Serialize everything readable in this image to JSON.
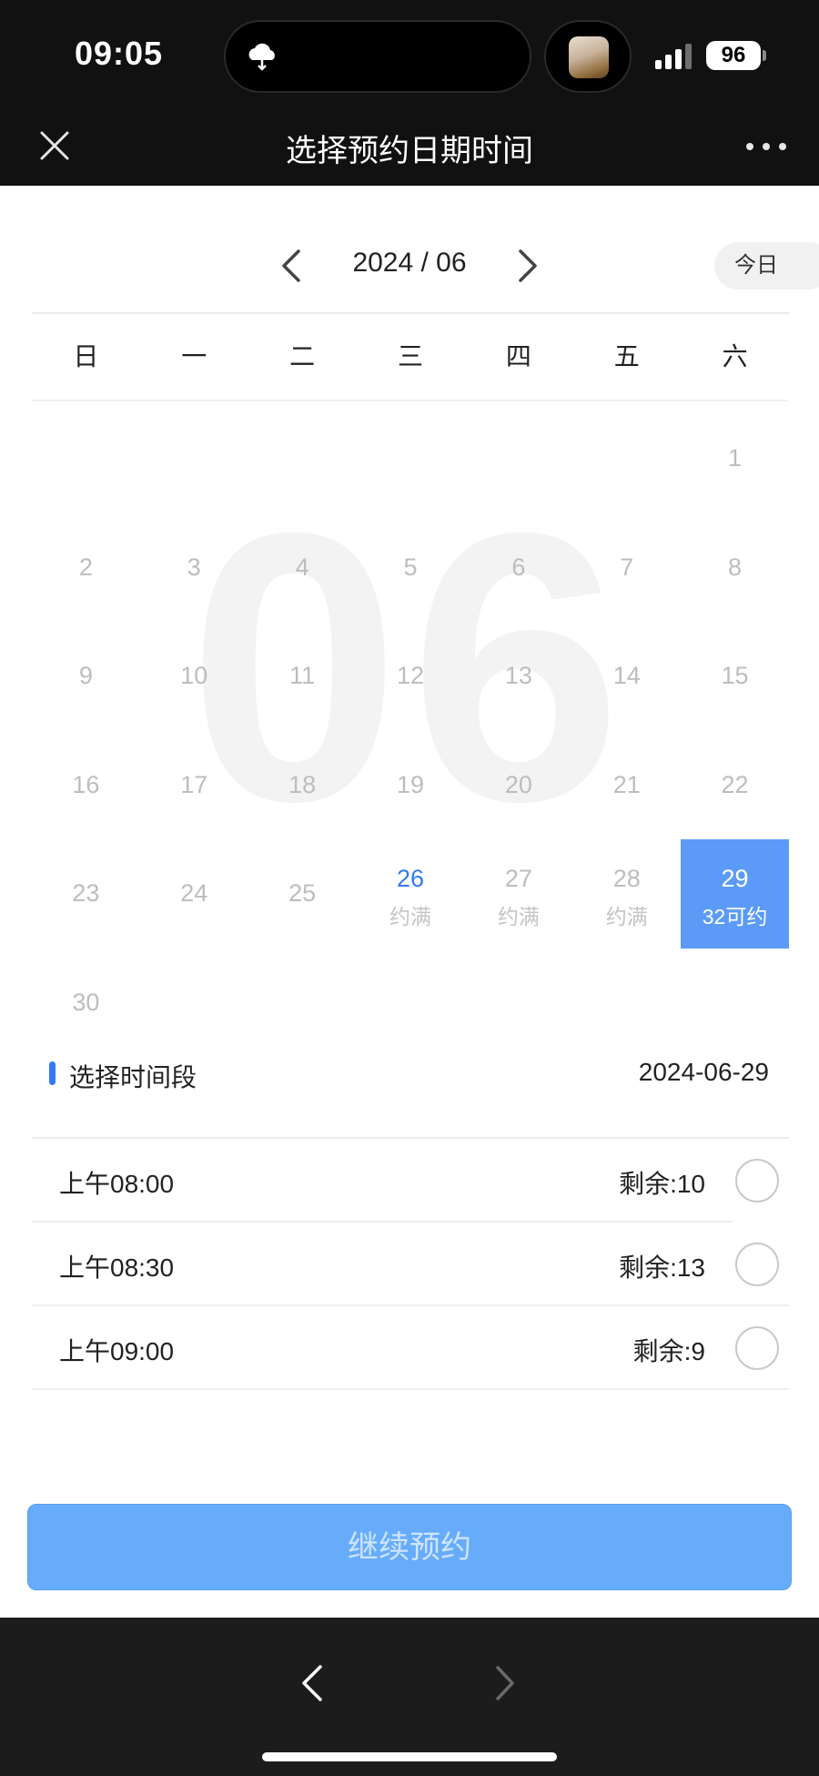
{
  "status_bar": {
    "time": "09:05",
    "battery": "96"
  },
  "header": {
    "title": "选择预约日期时间",
    "close_icon": "close-icon",
    "more_icon": "more-icon"
  },
  "calendar": {
    "month_label": "2024 / 06",
    "today_label": "今日",
    "watermark": "06",
    "weekdays": [
      "日",
      "一",
      "二",
      "三",
      "四",
      "五",
      "六"
    ],
    "days": [
      {
        "num": "",
        "sub": ""
      },
      {
        "num": "",
        "sub": ""
      },
      {
        "num": "",
        "sub": ""
      },
      {
        "num": "",
        "sub": ""
      },
      {
        "num": "",
        "sub": ""
      },
      {
        "num": "",
        "sub": ""
      },
      {
        "num": "1",
        "sub": ""
      },
      {
        "num": "2",
        "sub": ""
      },
      {
        "num": "3",
        "sub": ""
      },
      {
        "num": "4",
        "sub": ""
      },
      {
        "num": "5",
        "sub": ""
      },
      {
        "num": "6",
        "sub": ""
      },
      {
        "num": "7",
        "sub": ""
      },
      {
        "num": "8",
        "sub": ""
      },
      {
        "num": "9",
        "sub": ""
      },
      {
        "num": "10",
        "sub": ""
      },
      {
        "num": "11",
        "sub": ""
      },
      {
        "num": "12",
        "sub": ""
      },
      {
        "num": "13",
        "sub": ""
      },
      {
        "num": "14",
        "sub": ""
      },
      {
        "num": "15",
        "sub": ""
      },
      {
        "num": "16",
        "sub": ""
      },
      {
        "num": "17",
        "sub": ""
      },
      {
        "num": "18",
        "sub": ""
      },
      {
        "num": "19",
        "sub": ""
      },
      {
        "num": "20",
        "sub": ""
      },
      {
        "num": "21",
        "sub": ""
      },
      {
        "num": "22",
        "sub": ""
      },
      {
        "num": "23",
        "sub": ""
      },
      {
        "num": "24",
        "sub": ""
      },
      {
        "num": "25",
        "sub": ""
      },
      {
        "num": "26",
        "sub": "约满",
        "state": "avail"
      },
      {
        "num": "27",
        "sub": "约满"
      },
      {
        "num": "28",
        "sub": "约满"
      },
      {
        "num": "29",
        "sub": "32可约",
        "state": "selected"
      },
      {
        "num": "30",
        "sub": ""
      }
    ]
  },
  "time_slots": {
    "title": "选择时间段",
    "selected_date": "2024-06-29",
    "slots": [
      {
        "time": "上午08:00",
        "remaining": "剩余:10"
      },
      {
        "time": "上午08:30",
        "remaining": "剩余:13"
      },
      {
        "time": "上午09:00",
        "remaining": "剩余:9"
      }
    ]
  },
  "actions": {
    "continue_label": "继续预约"
  },
  "colors": {
    "accent": "#3478f6",
    "selected_day": "#5b9bf7",
    "button": "#66acfb"
  }
}
